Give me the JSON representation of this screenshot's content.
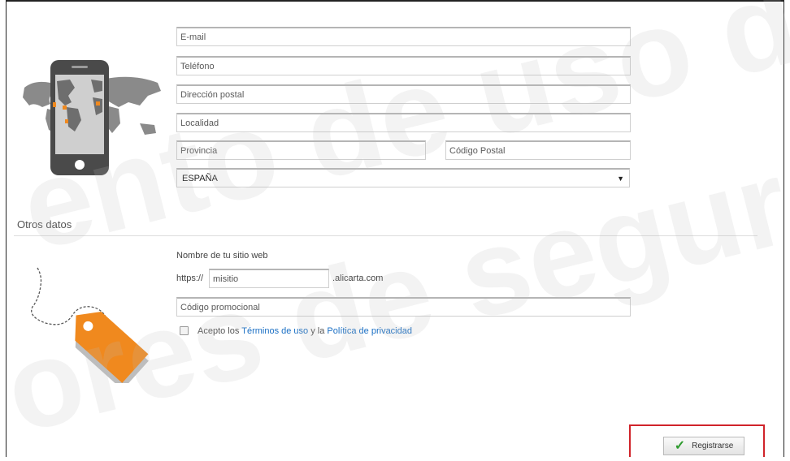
{
  "contact": {
    "email_placeholder": "E-mail",
    "phone_placeholder": "Teléfono",
    "address_placeholder": "Dirección postal",
    "city_placeholder": "Localidad",
    "province_placeholder": "Provincia",
    "postal_code_placeholder": "Código Postal",
    "country_selected": "ESPAÑA",
    "country_caret": "▼"
  },
  "other": {
    "section_title": "Otros datos",
    "website_label": "Nombre de tu sitio web",
    "url_prefix": "https://",
    "site_value": "misitio",
    "url_suffix": ".alicarta.com",
    "promo_placeholder": "Código promocional",
    "terms_prefix": "Acepto los",
    "terms_link": "Términos de uso",
    "terms_middle": "y la",
    "privacy_link": "Política de privacidad"
  },
  "actions": {
    "register_label": "Registrarse",
    "register_icon": "checkmark-icon"
  },
  "watermark": {
    "line1": "ento de uso de",
    "line2": "ores de seguros de"
  },
  "colors": {
    "highlight": "#d0232a",
    "accent_orange": "#f0891e",
    "phone_dark": "#4a4a4a",
    "link": "#1a6fc4",
    "check_green": "#2e9b2e"
  }
}
